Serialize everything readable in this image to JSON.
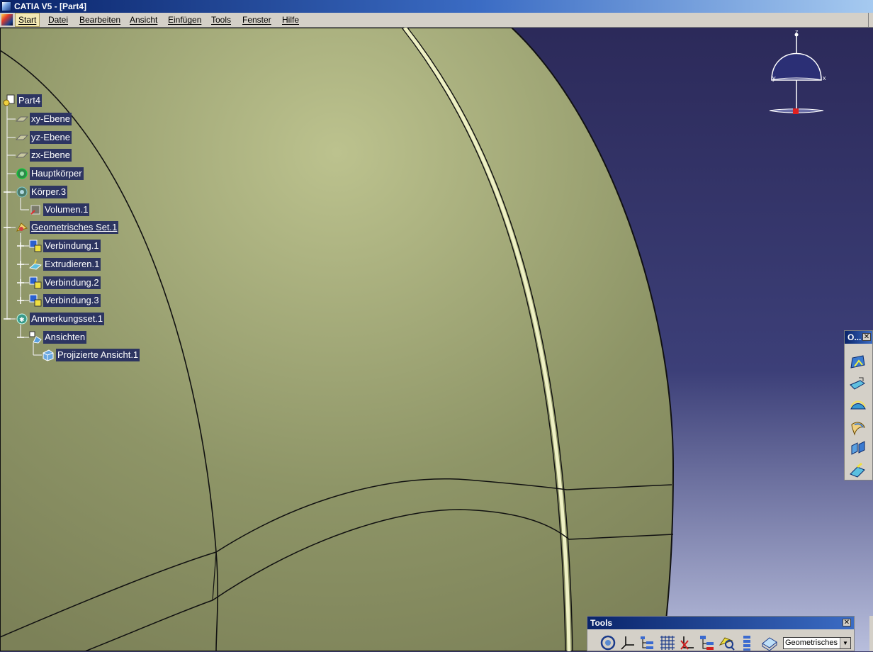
{
  "window": {
    "title": "CATIA V5 - [Part4]"
  },
  "menu": {
    "items": [
      {
        "label": "Start"
      },
      {
        "label": "Datei"
      },
      {
        "label": "Bearbeiten"
      },
      {
        "label": "Ansicht"
      },
      {
        "label": "Einfügen"
      },
      {
        "label": "Tools"
      },
      {
        "label": "Fenster"
      },
      {
        "label": "Hilfe"
      }
    ]
  },
  "tree": {
    "root": "Part4",
    "nodes": [
      {
        "label": "xy-Ebene",
        "icon": "plane-icon"
      },
      {
        "label": "yz-Ebene",
        "icon": "plane-icon"
      },
      {
        "label": "zx-Ebene",
        "icon": "plane-icon"
      },
      {
        "label": "Hauptkörper",
        "icon": "body-gear-icon"
      },
      {
        "label": "Körper.3",
        "icon": "body-gear-icon"
      },
      {
        "label": "Volumen.1",
        "icon": "volume-icon"
      },
      {
        "label": "Geometrisches Set.1",
        "icon": "geometrical-set-icon"
      },
      {
        "label": "Verbindung.1",
        "icon": "join-icon"
      },
      {
        "label": "Extrudieren.1",
        "icon": "extrude-icon"
      },
      {
        "label": "Verbindung.2",
        "icon": "join-icon"
      },
      {
        "label": "Verbindung.3",
        "icon": "join-icon"
      },
      {
        "label": "Anmerkungsset.1",
        "icon": "annotation-set-icon"
      },
      {
        "label": "Ansichten",
        "icon": "views-icon"
      },
      {
        "label": "Projizierte Ansicht.1",
        "icon": "projected-view-icon"
      }
    ]
  },
  "compass": {
    "axes": [
      "z",
      "y",
      "x"
    ]
  },
  "operations_toolbar": {
    "title": "O...",
    "buttons": [
      "surface-icon",
      "extrude-surface-icon",
      "offset-icon",
      "fill-icon",
      "split-icon",
      "sweep-icon"
    ]
  },
  "tools_toolbar": {
    "title": "Tools",
    "buttons": [
      "update-icon",
      "axis-system-icon",
      "spec-tree-icon",
      "grid-icon",
      "snap-icon",
      "hierarchy-icon",
      "search-icon",
      "list-icon",
      "3d-annotation-icon"
    ],
    "combo_value": "Geometrisches S"
  },
  "colors": {
    "background_top": "#2c2a5a",
    "background_bottom": "#b8bedc",
    "surface": "#b0b683",
    "tree_label_bg": "#2d3561",
    "titlebar": "#0a246a"
  }
}
